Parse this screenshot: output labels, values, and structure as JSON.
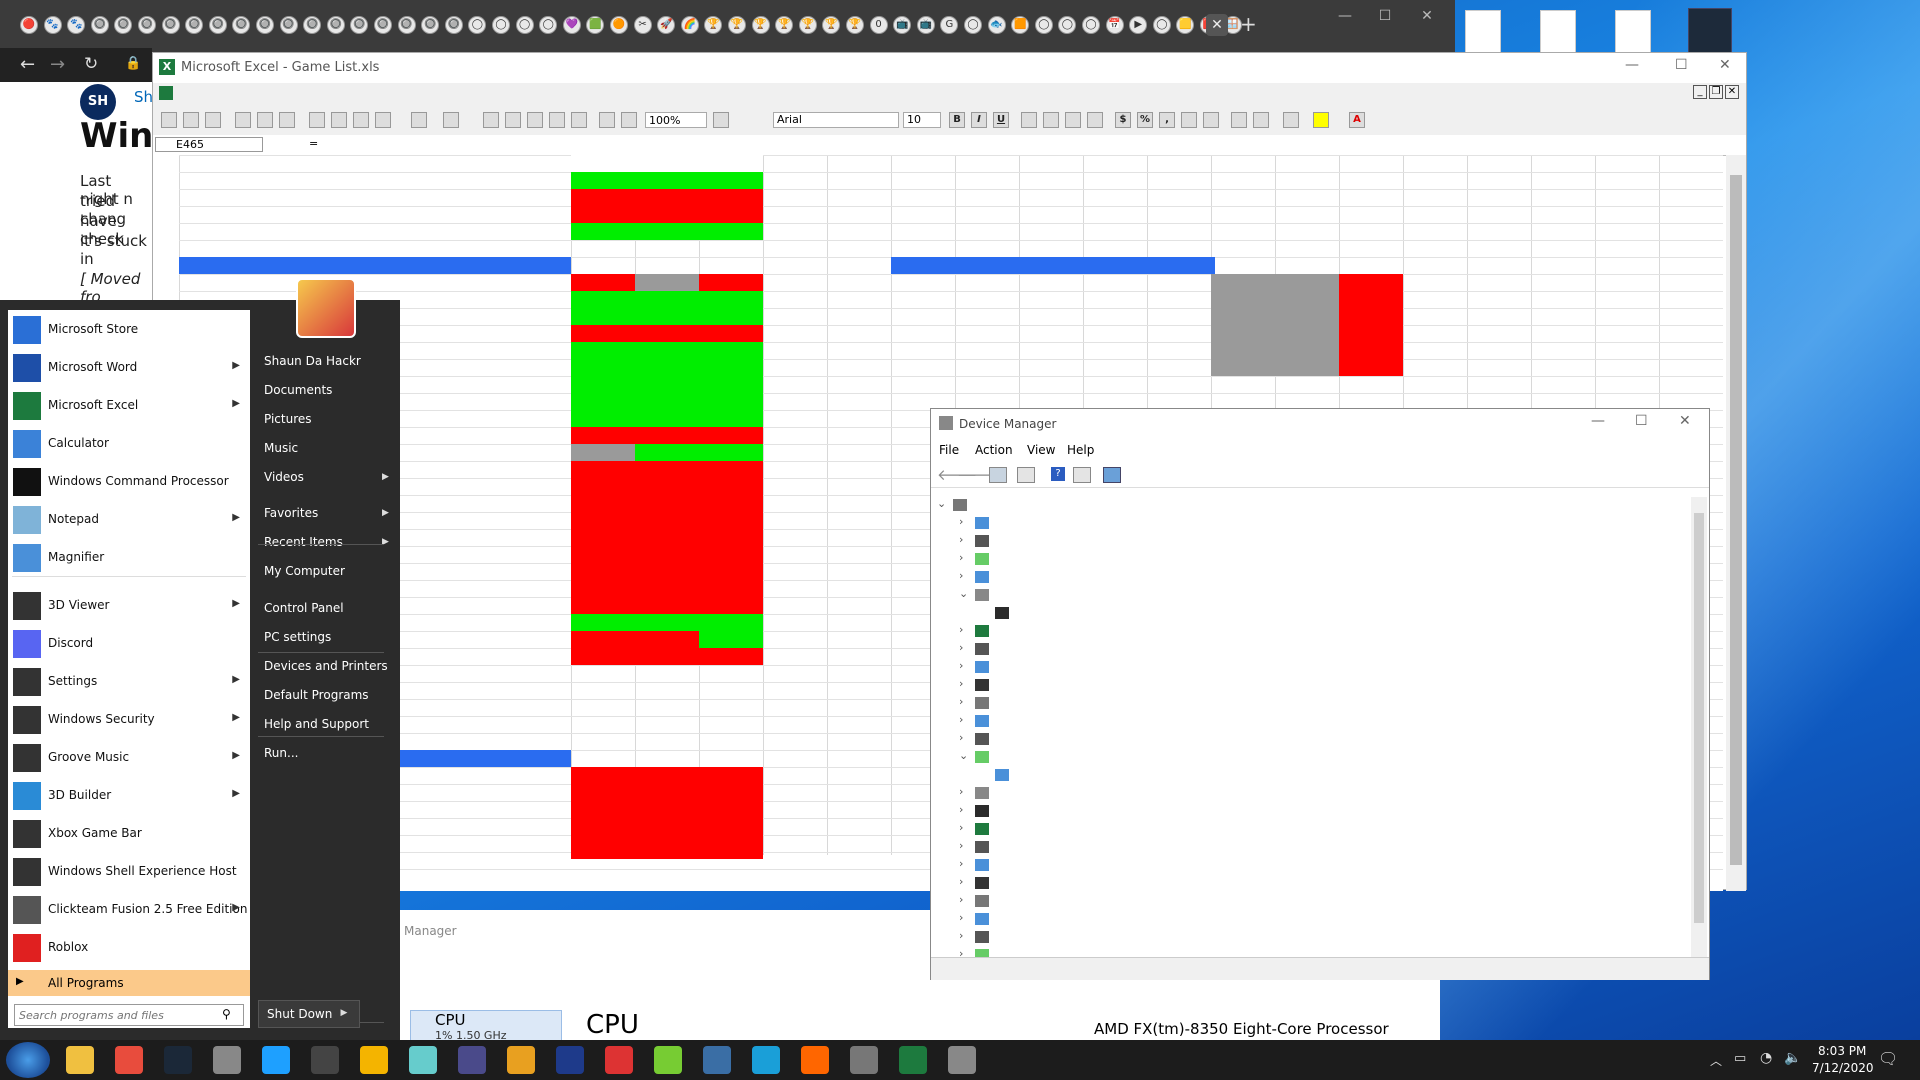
{
  "chrome": {
    "new_tab": "+",
    "tab_icons": [
      "🔴",
      "🐾",
      "🐾",
      "🔘",
      "🔘",
      "🔘",
      "🔘",
      "🔘",
      "🔘",
      "🔘",
      "🔘",
      "🔘",
      "🔘",
      "🔘",
      "🔘",
      "🔘",
      "🔘",
      "🔘",
      "🔘",
      "◯",
      "◯",
      "◯",
      "◯",
      "💜",
      "🟩",
      "🟠",
      "✂",
      "🚀",
      "🌈",
      "🏆",
      "🏆",
      "🏆",
      "🏆",
      "🏆",
      "🏆",
      "🏆",
      "0",
      "📺",
      "📺",
      "G",
      "◯",
      "🐟",
      "🟧",
      "◯",
      "◯",
      "◯",
      "📅",
      "▶",
      "◯",
      "🟨",
      "🟥",
      "🪟"
    ],
    "page": {
      "avatar": "SH",
      "author": "Sh",
      "heading": "Wind",
      "lines": [
        "Last night n",
        "tried chang",
        "have check",
        "it's stuck in"
      ],
      "moved": "[ Moved fro"
    }
  },
  "excel": {
    "title": "Microsoft Excel - Game List.xls",
    "name_box": "E465",
    "formula_eq": "=",
    "zoom": "100%",
    "font": "Arial",
    "font_size": "10",
    "bold": "B",
    "italic": "I",
    "underline": "U",
    "currency": "$",
    "percent": "%",
    "comma": ","
  },
  "start_menu": {
    "pinned": [
      {
        "label": "Microsoft Store",
        "arrow": false,
        "color": "#2a6fd6"
      },
      {
        "label": "Microsoft Word",
        "arrow": true,
        "color": "#1e4fa8"
      },
      {
        "label": "Microsoft Excel",
        "arrow": true,
        "color": "#1d7a3e"
      },
      {
        "label": "Calculator",
        "arrow": false,
        "color": "#3b82d8"
      },
      {
        "label": "Windows Command Processor",
        "arrow": false,
        "color": "#111111"
      },
      {
        "label": "Notepad",
        "arrow": true,
        "color": "#7fb3d8"
      },
      {
        "label": "Magnifier",
        "arrow": false,
        "color": "#4a90d9"
      }
    ],
    "recent": [
      {
        "label": "3D Viewer",
        "arrow": true,
        "color": "#333333"
      },
      {
        "label": "Discord",
        "arrow": false,
        "color": "#5865f2"
      },
      {
        "label": "Settings",
        "arrow": true,
        "color": "#333333"
      },
      {
        "label": "Windows Security",
        "arrow": true,
        "color": "#333333"
      },
      {
        "label": "Groove Music",
        "arrow": true,
        "color": "#333333"
      },
      {
        "label": "3D Builder",
        "arrow": true,
        "color": "#2a8bd6"
      },
      {
        "label": "Xbox Game Bar",
        "arrow": false,
        "color": "#333333"
      },
      {
        "label": "Windows Shell Experience Host",
        "arrow": false,
        "color": "#333333"
      },
      {
        "label": "Clickteam Fusion 2.5 Free Edition",
        "arrow": true,
        "color": "#555555"
      },
      {
        "label": "Roblox",
        "arrow": false,
        "color": "#e02020"
      }
    ],
    "all_programs": "All Programs",
    "search_placeholder": "Search programs and files",
    "right_items": [
      {
        "label": "Shaun Da Hackr",
        "arrow": false
      },
      {
        "label": "Documents",
        "arrow": false
      },
      {
        "label": "Pictures",
        "arrow": false
      },
      {
        "label": "Music",
        "arrow": false
      },
      {
        "label": "Videos",
        "arrow": true
      },
      {
        "label": "Favorites",
        "arrow": true
      },
      {
        "label": "Recent Items",
        "arrow": true
      },
      {
        "label": "My Computer",
        "arrow": false
      },
      {
        "label": "Control Panel",
        "arrow": false
      },
      {
        "label": "PC settings",
        "arrow": false
      },
      {
        "label": "Devices and Printers",
        "arrow": false
      },
      {
        "label": "Default Programs",
        "arrow": false
      },
      {
        "label": "Help and Support",
        "arrow": false
      },
      {
        "label": "Run...",
        "arrow": false
      }
    ],
    "shutdown": "Shut Down"
  },
  "device_manager": {
    "title": "Device Manager",
    "menu": [
      "File",
      "Action",
      "View",
      "Help"
    ]
  },
  "task_manager": {
    "behind_title": "Manager",
    "cpu_label": "CPU",
    "cpu_detail": "1% 1.50 GHz",
    "cpu_heading": "CPU",
    "processor": "AMD FX(tm)-8350 Eight-Core Processor"
  },
  "taskbar": {
    "time": "8:03 PM",
    "date": "7/12/2020"
  }
}
